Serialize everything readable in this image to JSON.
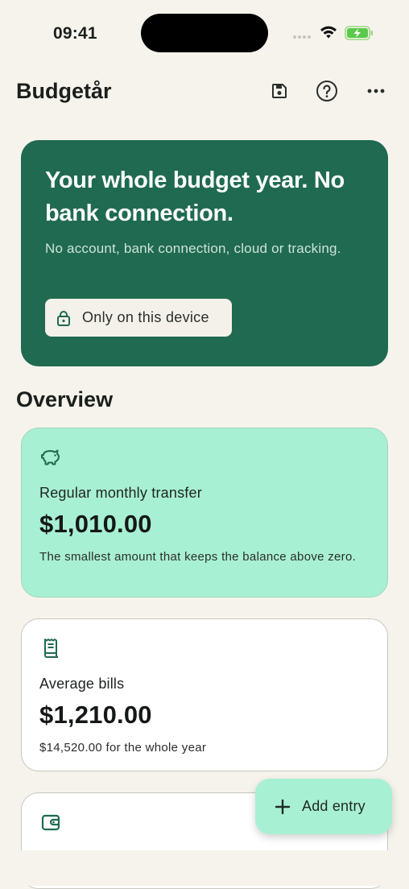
{
  "status_bar": {
    "time": "09:41"
  },
  "header": {
    "app_title": "Budgetår",
    "actions": [
      {
        "icon": "save-icon"
      },
      {
        "icon": "help-icon"
      },
      {
        "icon": "more-icon"
      }
    ]
  },
  "hero": {
    "title": "Your whole budget year. No bank connection.",
    "subtitle": "No account, bank connection, cloud or tracking.",
    "device_badge": {
      "icon": "lock-icon",
      "label": "Only on this device"
    }
  },
  "overview": {
    "title": "Overview",
    "cards": [
      {
        "icon": "piggy-bank-icon",
        "label": "Regular monthly transfer",
        "value": "$1,010.00",
        "note": "The smallest amount that keeps the balance above zero."
      },
      {
        "icon": "receipt-icon",
        "label": "Average bills",
        "value": "$1,210.00",
        "note": "$14,520.00 for the whole year"
      },
      {
        "icon": "wallet-icon",
        "label": "",
        "value": "",
        "note": ""
      }
    ]
  },
  "fab": {
    "icon": "plus-icon",
    "label": "Add entry"
  },
  "colors": {
    "background": "#f6f3ed",
    "hero": "#1f6a50",
    "accent_mint": "#a8f0d4",
    "icon_green": "#1f6a50"
  }
}
